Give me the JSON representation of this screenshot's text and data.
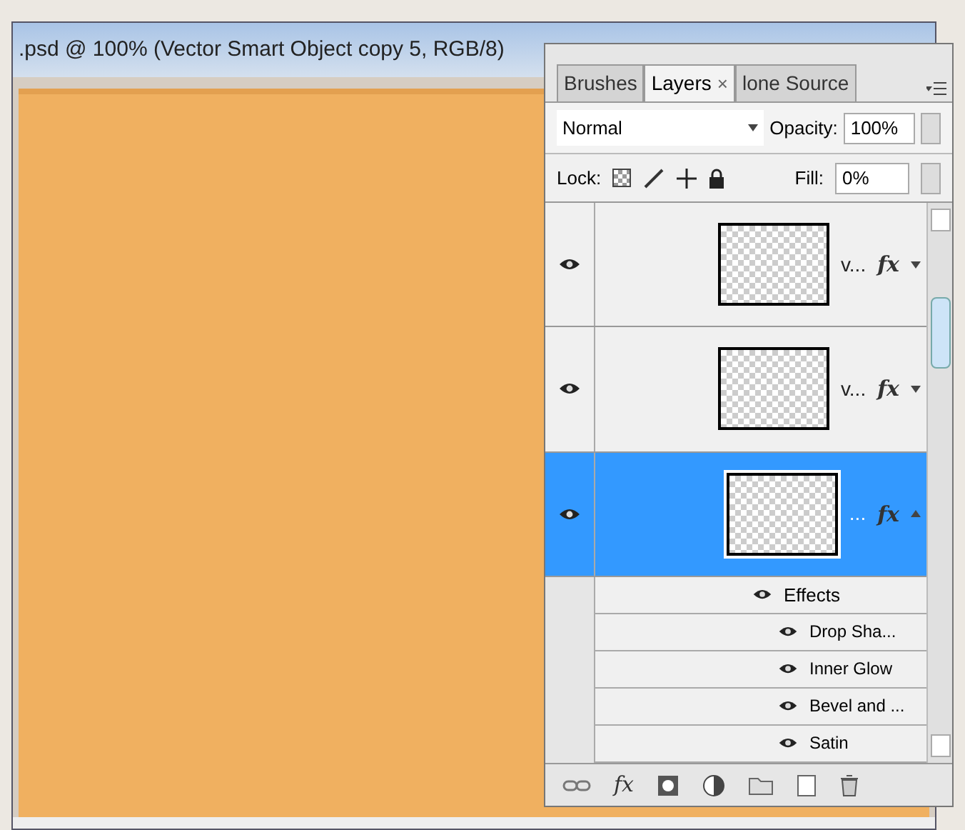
{
  "document": {
    "title": ".psd @ 100% (Vector Smart Object copy 5, RGB/8)"
  },
  "panel": {
    "tabs": [
      {
        "label": "Brushes",
        "selected": false
      },
      {
        "label": "Layers",
        "selected": true
      },
      {
        "label": "lone Source",
        "selected": false
      }
    ],
    "close_label": "×",
    "fx_button": "fx",
    "blend_mode": "Normal",
    "opacity_label": "Opacity:",
    "opacity": "100%",
    "lock_label": "Lock:",
    "fill_label": "Fill:",
    "fill": "0%",
    "layers": [
      {
        "name": "v...",
        "visible": true,
        "selected": false,
        "fx": "fx"
      },
      {
        "name": "v...",
        "visible": true,
        "selected": false,
        "fx": "fx"
      },
      {
        "name": "...",
        "visible": true,
        "selected": true,
        "fx": "fx"
      }
    ],
    "effects": {
      "label": "Effects",
      "visible": true,
      "items": [
        {
          "name": "Drop Sha...",
          "visible": true
        },
        {
          "name": "Inner Glow",
          "visible": true
        },
        {
          "name": "Bevel and ...",
          "visible": true
        },
        {
          "name": "Satin",
          "visible": true
        }
      ]
    }
  }
}
